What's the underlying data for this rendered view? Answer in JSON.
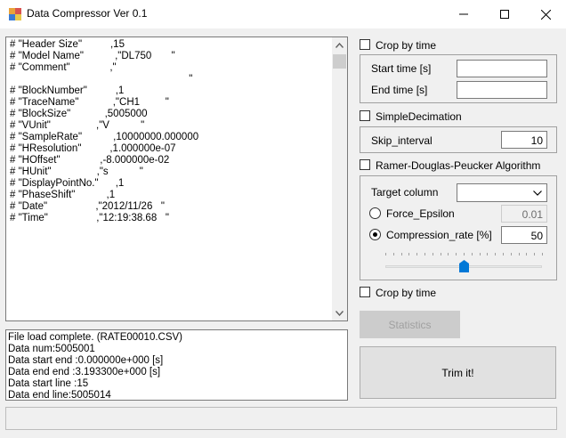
{
  "window": {
    "title": "Data Compressor Ver 0.1",
    "minimize_glyph": "─",
    "maximize_glyph": "☐",
    "close_glyph": "✕"
  },
  "header_text": {
    "lines": [
      "# \"Header Size\"          ,15",
      "# \"Model Name\"           ,\"DL750       \"",
      "# \"Comment\"              ,\"",
      "                                                               \"",
      "# \"BlockNumber\"          ,1",
      "# \"TraceName\"            ,\"CH1         \"",
      "# \"BlockSize\"            ,5005000",
      "# \"VUnit\"                ,\"V           \"",
      "# \"SampleRate\"           ,10000000.000000",
      "# \"HResolution\"          ,1.000000e-07",
      "# \"HOffset\"              ,-8.000000e-02",
      "# \"HUnit\"                ,\"s           \"",
      "# \"DisplayPointNo.\"      ,1",
      "# \"PhaseShift\"           ,1",
      "# \"Date\"                 ,\"2012/11/26   \"",
      "# \"Time\"                 ,\"12:19:38.68   \""
    ]
  },
  "log": {
    "lines": [
      "File load complete. (RATE00010.CSV)",
      "Data num:5005001",
      "Data start end :0.000000e+000 [s]",
      "Data end end :3.193300e+000 [s]",
      "Data start line :15",
      "Data end line:5005014"
    ]
  },
  "crop_time_top": {
    "label": "Crop by time",
    "checked": false
  },
  "start_time": {
    "label": "Start time [s]",
    "value": ""
  },
  "end_time": {
    "label": "End time [s]",
    "value": ""
  },
  "simple_decimation": {
    "label": "SimpleDecimation",
    "checked": false
  },
  "skip_interval": {
    "label": "Skip_interval",
    "value": "10"
  },
  "rdp": {
    "label": "Ramer-Douglas-Peucker Algorithm",
    "checked": false
  },
  "target_column": {
    "label": "Target column",
    "value": ""
  },
  "force_epsilon": {
    "label": "Force_Epsilon",
    "value": "0.01",
    "selected": false
  },
  "compression_rate": {
    "label": "Compression_rate [%]",
    "value": "50",
    "selected": true
  },
  "compression_slider": {
    "value": 50,
    "min": 0,
    "max": 100
  },
  "crop_time_bottom": {
    "label": "Crop by time",
    "checked": false
  },
  "buttons": {
    "statistics": "Statistics",
    "trim": "Trim it!"
  },
  "colors": {
    "accent": "#0078d7",
    "window_bg": "#f0f0f0"
  }
}
